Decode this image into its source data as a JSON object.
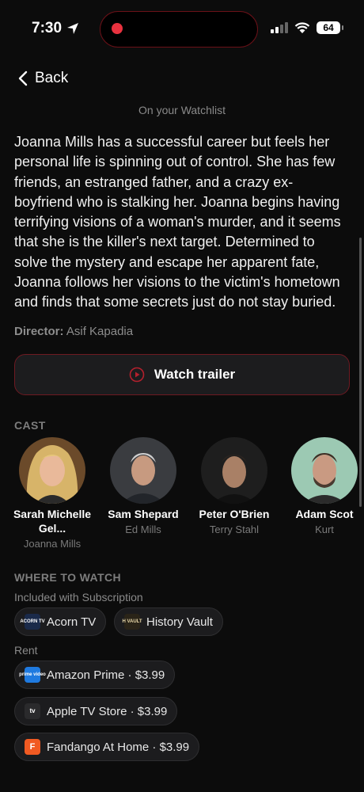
{
  "status_bar": {
    "time": "7:30",
    "battery": "64",
    "location_icon": "location-arrow-icon",
    "wifi_icon": "wifi-icon",
    "signal_icon": "cellular-signal-icon"
  },
  "nav": {
    "back_label": "Back"
  },
  "watchlist_note": "On your Watchlist",
  "description": "Joanna Mills has a successful career but feels her personal life is spinning out of control. She has few friends, an estranged father, and a crazy ex-boyfriend who is stalking her. Joanna begins having terrifying visions of a woman's murder, and it seems that she is the killer's next target. Determined to solve the mystery and escape her apparent fate, Joanna follows her visions to the victim's hometown and finds that some secrets just do not stay buried.",
  "director": {
    "label": "Director:",
    "name": "Asif Kapadia"
  },
  "trailer": {
    "label": "Watch trailer",
    "icon": "play-circle-icon"
  },
  "cast": {
    "heading": "CAST",
    "members": [
      {
        "name": "Sarah Michelle Gel...",
        "role": "Joanna Mills"
      },
      {
        "name": "Sam Shepard",
        "role": "Ed Mills"
      },
      {
        "name": "Peter O'Brien",
        "role": "Terry Stahl"
      },
      {
        "name": "Adam Scot",
        "role": "Kurt"
      }
    ]
  },
  "where_to_watch": {
    "heading": "WHERE TO WATCH",
    "subscription": {
      "label": "Included with Subscription",
      "services": [
        {
          "name": "Acorn TV",
          "logo_text": "ACORN TV"
        },
        {
          "name": "History Vault",
          "logo_text": "H VAULT"
        }
      ]
    },
    "rent": {
      "label": "Rent",
      "services": [
        {
          "name": "Amazon Prime · $3.99",
          "logo_text": "prime video"
        },
        {
          "name": "Apple TV Store · $3.99",
          "logo_text": "tv"
        },
        {
          "name": "Fandango At Home · $3.99",
          "logo_text": "F"
        }
      ]
    }
  },
  "colors": {
    "background": "#0c0c0c",
    "accent": "#e8323f",
    "button_border": "#6e1a22",
    "pill_bg": "#1c1c1e"
  }
}
